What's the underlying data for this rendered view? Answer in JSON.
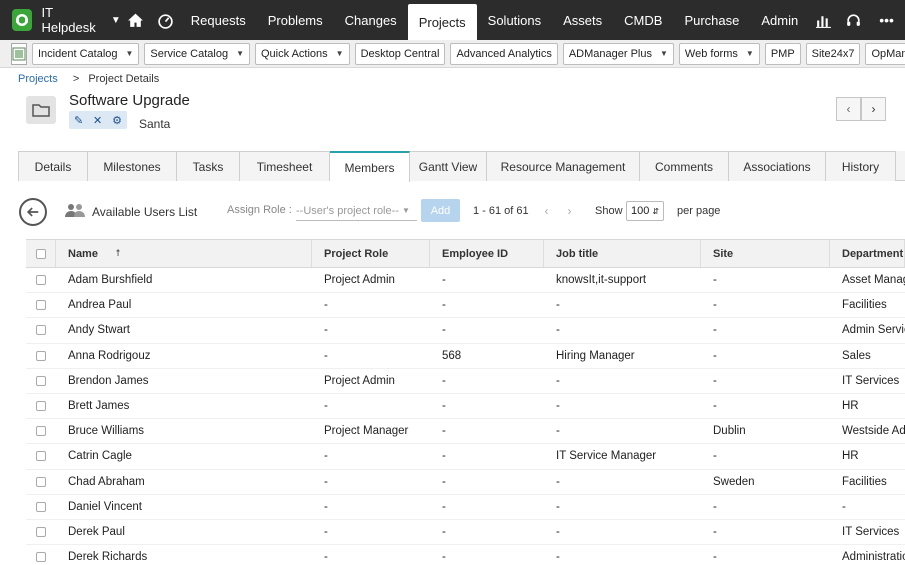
{
  "app": {
    "name": "IT Helpdesk"
  },
  "nav": {
    "items": [
      {
        "label": "Requests",
        "active": false
      },
      {
        "label": "Problems",
        "active": false
      },
      {
        "label": "Changes",
        "active": false
      },
      {
        "label": "Projects",
        "active": true
      },
      {
        "label": "Solutions",
        "active": false
      },
      {
        "label": "Assets",
        "active": false
      },
      {
        "label": "CMDB",
        "active": false
      },
      {
        "label": "Purchase",
        "active": false
      },
      {
        "label": "Admin",
        "active": false
      }
    ],
    "more": "•••"
  },
  "toolbar": {
    "buttons": [
      {
        "label": "Incident Catalog",
        "dropdown": true
      },
      {
        "label": "Service Catalog",
        "dropdown": true
      },
      {
        "label": "Quick Actions",
        "dropdown": true
      },
      {
        "label": "Desktop Central",
        "dropdown": false
      },
      {
        "label": "Advanced Analytics",
        "dropdown": false
      },
      {
        "label": "ADManager Plus",
        "dropdown": true
      },
      {
        "label": "Web forms",
        "dropdown": true
      },
      {
        "label": "PMP",
        "dropdown": false
      },
      {
        "label": "Site24x7",
        "dropdown": false
      },
      {
        "label": "OpManager",
        "dropdown": false
      }
    ]
  },
  "breadcrumb": {
    "root": "Projects",
    "separator": ">",
    "current": "Project Details"
  },
  "project": {
    "title": "Software Upgrade",
    "owner": "Santa"
  },
  "tabs": [
    {
      "label": "Details",
      "width": 70
    },
    {
      "label": "Milestones",
      "width": 89
    },
    {
      "label": "Tasks",
      "width": 63
    },
    {
      "label": "Timesheet",
      "width": 90
    },
    {
      "label": "Members",
      "width": 80,
      "active": true
    },
    {
      "label": "Gantt View",
      "width": 77
    },
    {
      "label": "Resource Management",
      "width": 153
    },
    {
      "label": "Comments",
      "width": 89
    },
    {
      "label": "Associations",
      "width": 97
    },
    {
      "label": "History",
      "width": 70
    }
  ],
  "members": {
    "list_title": "Available Users List",
    "assign_label": "Assign Role :",
    "role_placeholder": "--User's project role--",
    "add_label": "Add",
    "range": "1 - 61 of 61",
    "show_label": "Show",
    "page_size": "100",
    "per_page_label": "per page"
  },
  "table": {
    "columns": [
      "Name",
      "Project Role",
      "Employee ID",
      "Job title",
      "Site",
      "Department"
    ],
    "rows": [
      [
        "Adam Burshfield",
        "Project Admin",
        "-",
        "knowsIt,it-support",
        "-",
        "Asset Management"
      ],
      [
        "Andrea Paul",
        "-",
        "-",
        "-",
        "-",
        "Facilities"
      ],
      [
        "Andy Stwart",
        "-",
        "-",
        "-",
        "-",
        "Admin Services"
      ],
      [
        "Anna Rodrigouz",
        "-",
        "568",
        "Hiring Manager",
        "-",
        "Sales"
      ],
      [
        "Brendon James",
        "Project Admin",
        "-",
        "-",
        "-",
        "IT Services"
      ],
      [
        "Brett James",
        "-",
        "-",
        "-",
        "-",
        "HR"
      ],
      [
        "Bruce Williams",
        "Project Manager",
        "-",
        "-",
        "Dublin",
        "Westside Admin"
      ],
      [
        "Catrin Cagle",
        "-",
        "-",
        "IT Service Manager",
        "-",
        "HR"
      ],
      [
        "Chad Abraham",
        "-",
        "-",
        "-",
        "Sweden",
        "Facilities"
      ],
      [
        "Daniel Vincent",
        "-",
        "-",
        "-",
        "-",
        "-"
      ],
      [
        "Derek Paul",
        "-",
        "-",
        "-",
        "-",
        "IT Services"
      ],
      [
        "Derek Richards",
        "-",
        "-",
        "-",
        "-",
        "Administration"
      ]
    ]
  }
}
